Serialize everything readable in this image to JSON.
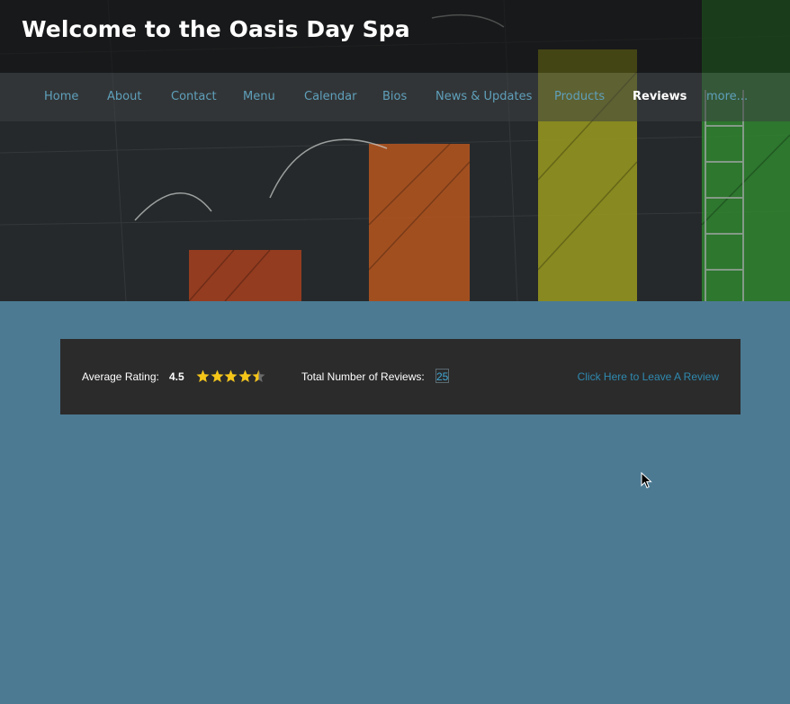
{
  "site": {
    "title": "Welcome to the Oasis Day Spa"
  },
  "nav": {
    "items": [
      {
        "label": "Home",
        "active": false
      },
      {
        "label": "About",
        "active": false
      },
      {
        "label": "Contact",
        "active": false
      },
      {
        "label": "Menu",
        "active": false
      },
      {
        "label": "Calendar",
        "active": false
      },
      {
        "label": "Bios",
        "active": false
      },
      {
        "label": "News & Updates",
        "active": false
      },
      {
        "label": "Products",
        "active": false
      },
      {
        "label": "Reviews",
        "active": true
      },
      {
        "label": "more...",
        "active": false
      }
    ]
  },
  "reviews": {
    "average_label": "Average Rating:",
    "average_value": "4.5",
    "rating": 4.5,
    "rating_max": 5,
    "total_label": "Total Number of Reviews:",
    "total_value": "25",
    "leave_review_link": "Click Here to Leave A Review"
  },
  "colors": {
    "page_background": "#4c7a93",
    "nav_link": "#5fa0bb",
    "nav_active": "#ffffff",
    "star": "#f5c518",
    "review_link": "#2f8ab0"
  },
  "icons": {
    "star": "star-icon",
    "half_star": "star-half-icon",
    "cursor": "mouse-cursor-icon"
  }
}
